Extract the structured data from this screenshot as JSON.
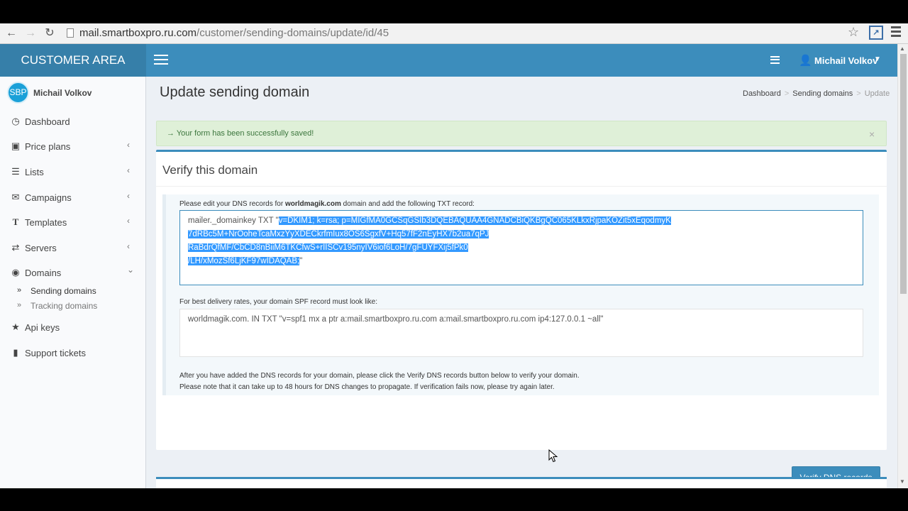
{
  "browser": {
    "url_host": "mail.smartboxpro.ru.com",
    "url_path": "/customer/sending-domains/update/id/45",
    "back_icon": "arrow-left-icon",
    "forward_icon": "arrow-right-icon",
    "reload_icon": "reload-icon",
    "star_icon": "star-icon"
  },
  "header": {
    "logo": "CUSTOMER AREA",
    "user_name": "Michail Volkov",
    "accent": "#3c8dbc"
  },
  "sidebar": {
    "avatar_text": "SBP",
    "user_name": "Michail Volkov",
    "items": [
      {
        "label": "Dashboard",
        "icon": "dashboard-icon"
      },
      {
        "label": "Price plans",
        "icon": "credit-card-icon"
      },
      {
        "label": "Lists",
        "icon": "list-icon"
      },
      {
        "label": "Campaigns",
        "icon": "envelope-icon"
      },
      {
        "label": "Templates",
        "icon": "text-icon"
      },
      {
        "label": "Servers",
        "icon": "exchange-icon"
      },
      {
        "label": "Domains",
        "icon": "globe-icon"
      },
      {
        "label": "Api keys",
        "icon": "star-icon"
      },
      {
        "label": "Support tickets",
        "icon": "book-icon"
      }
    ],
    "domains_sub": [
      {
        "label": "Sending domains"
      },
      {
        "label": "Tracking domains"
      }
    ]
  },
  "page": {
    "title": "Update sending domain",
    "breadcrumb": [
      "Dashboard",
      "Sending domains",
      "Update"
    ]
  },
  "alert": {
    "message": "→ Your form has been successfully saved!",
    "close": "×"
  },
  "verify": {
    "title": "Verify this domain",
    "intro_pre": "Please edit your DNS records for ",
    "domain": "worldmagik.com",
    "intro_post": " domain and add the following TXT record:",
    "dns_record_prefix": "mailer._domainkey      TXT    \"",
    "dns_lines": [
      "v=DKIM1; k=rsa; p=MIGfMA0GCSqGSIb3DQEBAQUAA4GNADCBiQKBgQC065KLkxRjpaKOZit5xEqodmyK",
      "7dRBc5M+NrOoheTcaMxzYyXDECkrfmIux8OS6SgxfV+Hq57fF2nEyHX7b2ua7qPJ",
      "RaBdrQfMF/CbCD8nBiiM6TKCfwS+rIISCv195nyIV6iof6LoH/7gFUYFXij5fPk0",
      "/LH/xMozSf6LjKF97wIDAQAB;"
    ],
    "dns_record_suffix": "\"",
    "spf_label": "For best delivery rates, your domain SPF record must look like:",
    "spf_record": "worldmagik.com.      IN TXT     \"v=spf1 mx a ptr a:mail.smartboxpro.ru.com a:mail.smartboxpro.ru.com ip4:127.0.0.1 ~all\"",
    "note_1": "After you have added the DNS records for your domain, please click the Verify DNS records button below to verify your domain.",
    "note_2": "Please note that it can take up to 48 hours for DNS changes to propagate. If verification fails now, please try again later.",
    "button_label": "Verify DNS records"
  }
}
